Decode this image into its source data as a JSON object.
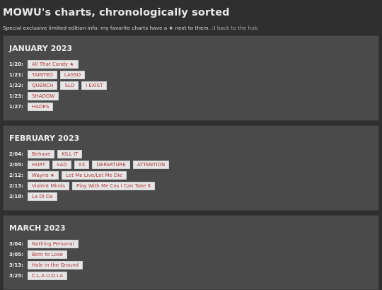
{
  "title": "MOWU's charts, chronologically sorted",
  "info": {
    "text": "Special exclusive limited edition info: my favorite charts have a ★ next to them. :)",
    "back_link": "back to the hub"
  },
  "months": [
    {
      "name": "JANUARY 2023",
      "rows": [
        {
          "date": "1/20:",
          "charts": [
            "All That Candy ★"
          ]
        },
        {
          "date": "1/21:",
          "charts": [
            "TAINTED",
            "LASSO"
          ]
        },
        {
          "date": "1/22:",
          "charts": [
            "QUENCH",
            "SLO",
            "I EXIST"
          ]
        },
        {
          "date": "1/23:",
          "charts": [
            "SHADOW"
          ]
        },
        {
          "date": "1/27:",
          "charts": [
            "HADES"
          ]
        }
      ]
    },
    {
      "name": "FEBRUARY 2023",
      "rows": [
        {
          "date": "2/04:",
          "charts": [
            "Behave",
            "KILL IT"
          ]
        },
        {
          "date": "2/05:",
          "charts": [
            "HURT",
            "SAD",
            "XX",
            "DEPARTURE",
            "ATTENTION"
          ]
        },
        {
          "date": "2/12:",
          "charts": [
            "Wayne ★",
            "Let Me Live/Let Me Die"
          ]
        },
        {
          "date": "2/13:",
          "charts": [
            "Violent Minds",
            "Play With Me Cos I Can Take It"
          ]
        },
        {
          "date": "2/18:",
          "charts": [
            "La Di Da"
          ]
        }
      ]
    },
    {
      "name": "MARCH 2023",
      "rows": [
        {
          "date": "3/04:",
          "charts": [
            "Nothing Personal"
          ]
        },
        {
          "date": "3/05:",
          "charts": [
            "Born to Lose"
          ]
        },
        {
          "date": "3/13:",
          "charts": [
            "Hole in the Ground"
          ]
        },
        {
          "date": "3/25:",
          "charts": [
            "C.L.A.U.D.I.A"
          ]
        }
      ]
    }
  ]
}
